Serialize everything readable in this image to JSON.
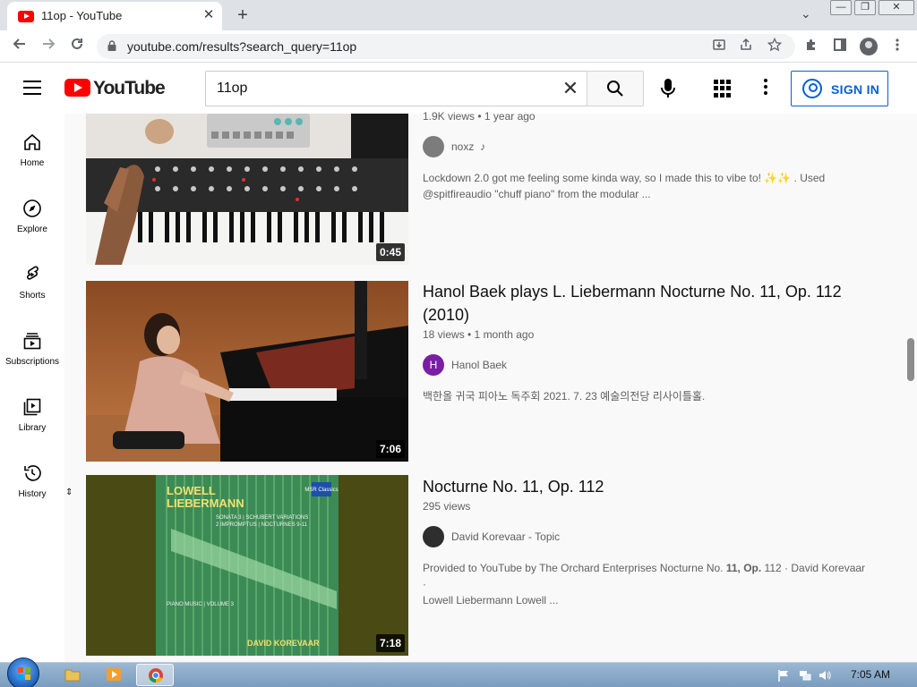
{
  "browser": {
    "tab_title": "11op - YouTube",
    "tab_close": "✕",
    "new_tab": "+",
    "tab_search": "⌄",
    "url": "youtube.com/results?search_query=11op",
    "window_minimize": "—",
    "window_restore": "❐",
    "window_close": "✕"
  },
  "youtube": {
    "logo_text": "YouTube",
    "search_query": "11op",
    "clear_symbol": "✕",
    "sign_in": "SIGN IN"
  },
  "sidebar": {
    "items": [
      {
        "label": "Home",
        "icon": "home-icon"
      },
      {
        "label": "Explore",
        "icon": "compass-icon"
      },
      {
        "label": "Shorts",
        "icon": "shorts-icon"
      },
      {
        "label": "Subscriptions",
        "icon": "subscriptions-icon"
      },
      {
        "label": "Library",
        "icon": "library-icon"
      },
      {
        "label": "History",
        "icon": "history-icon"
      }
    ]
  },
  "videos": [
    {
      "title": "",
      "meta": "1.9K views • 1 year ago",
      "duration": "0:45",
      "channel": "noxz",
      "channel_extra": "♪",
      "description_1": "Lockdown 2.0 got me feeling some kinda way, so I made this to vibe to! ✨✨ . Used",
      "description_2": "@spitfireaudio \"chuff piano\" from the modular ..."
    },
    {
      "title_line1": "Hanol Baek plays L. Liebermann Nocturne No. 11, Op. 112",
      "title_line2": "(2010)",
      "meta": "18 views • 1 month ago",
      "duration": "7:06",
      "channel": "Hanol Baek",
      "channel_initial": "H",
      "description_1": "백한올 귀국 피아노 독주회 2021. 7. 23 예술의전당 리사이틀홀."
    },
    {
      "title": "Nocturne No. 11, Op. 112",
      "meta": "295 views",
      "duration": "7:18",
      "channel": "David Korevaar - Topic",
      "desc_a": "Provided to YouTube by The Orchard Enterprises Nocturne No. ",
      "desc_b": "11, Op.",
      "desc_c": " 112 · David Korevaar ·",
      "description_2": "Lowell Liebermann Lowell ...",
      "album": {
        "artist_line1": "LOWELL",
        "artist_line2": "LIEBERMANN",
        "works_line1": "SONATA 3 | SCHUBERT VARIATIONS",
        "works_line2": "2 IMPROMPTUS | NOCTURNES 9-11",
        "series": "PIANO MUSIC | VOLUME 3",
        "performer": "DAVID KOREVAAR",
        "label": "MSR Classics"
      }
    }
  ],
  "taskbar": {
    "clock": "7:05 AM"
  }
}
